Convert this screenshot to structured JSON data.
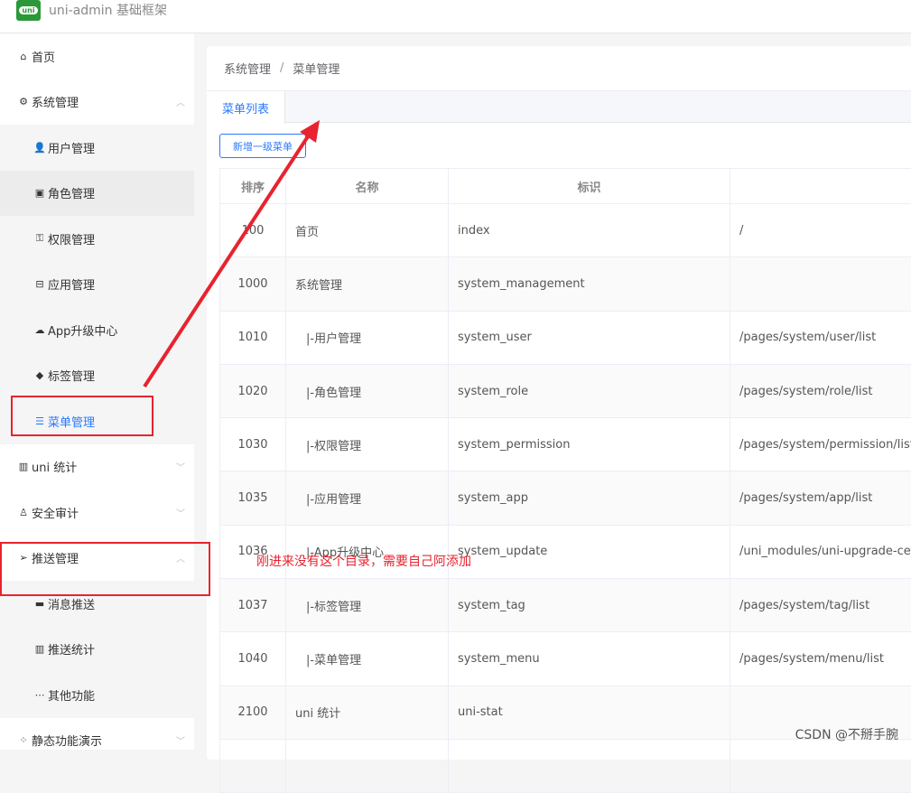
{
  "header": {
    "logo_text": "uni",
    "title": "uni-admin 基础框架"
  },
  "sidebar": {
    "items": [
      {
        "label": "首页",
        "icon": "home-icon",
        "level": 0
      },
      {
        "label": "系统管理",
        "icon": "gear-icon",
        "level": 0,
        "chev": "up"
      },
      {
        "label": "用户管理",
        "icon": "user-icon",
        "level": 1
      },
      {
        "label": "角色管理",
        "icon": "role-icon",
        "level": 1
      },
      {
        "label": "权限管理",
        "icon": "permission-icon",
        "level": 1
      },
      {
        "label": "应用管理",
        "icon": "app-icon",
        "level": 1
      },
      {
        "label": "App升级中心",
        "icon": "cloud-upload-icon",
        "level": 1
      },
      {
        "label": "标签管理",
        "icon": "tag-icon",
        "level": 1
      },
      {
        "label": "菜单管理",
        "icon": "list-icon",
        "level": 1,
        "active": true
      },
      {
        "label": "uni 统计",
        "icon": "chart-icon",
        "level": 0,
        "chev": "down"
      },
      {
        "label": "安全审计",
        "icon": "audit-icon",
        "level": 0,
        "chev": "down"
      },
      {
        "label": "推送管理",
        "icon": "send-icon",
        "level": 0,
        "chev": "up"
      },
      {
        "label": "消息推送",
        "icon": "message-icon",
        "level": 1
      },
      {
        "label": "推送统计",
        "icon": "chart-icon",
        "level": 1
      },
      {
        "label": "其他功能",
        "icon": "more-icon",
        "level": 1
      },
      {
        "label": "静态功能演示",
        "icon": "grid-icon",
        "level": 0,
        "chev": "down"
      }
    ]
  },
  "breadcrumb": {
    "parent": "系统管理",
    "sep": "/",
    "current": "菜单管理"
  },
  "tabs": {
    "active": "菜单列表"
  },
  "toolbar": {
    "add_label": "新增一级菜单"
  },
  "table": {
    "headers": [
      "排序",
      "名称",
      "标识",
      ""
    ],
    "rows": [
      [
        "100",
        "首页",
        "index",
        "/"
      ],
      [
        "1000",
        "系统管理",
        "system_management",
        ""
      ],
      [
        "1010",
        "|-用户管理",
        "system_user",
        "/pages/system/user/list"
      ],
      [
        "1020",
        "|-角色管理",
        "system_role",
        "/pages/system/role/list"
      ],
      [
        "1030",
        "|-权限管理",
        "system_permission",
        "/pages/system/permission/list"
      ],
      [
        "1035",
        "|-应用管理",
        "system_app",
        "/pages/system/app/list"
      ],
      [
        "1036",
        "|-App升级中心",
        "system_update",
        "/uni_modules/uni-upgrade-center"
      ],
      [
        "1037",
        "|-标签管理",
        "system_tag",
        "/pages/system/tag/list"
      ],
      [
        "1040",
        "|-菜单管理",
        "system_menu",
        "/pages/system/menu/list"
      ],
      [
        "2100",
        "uni 统计",
        "uni-stat",
        ""
      ],
      [
        "",
        "",
        "",
        ""
      ]
    ]
  },
  "annotation": {
    "note": "刚进来没有这个目录，需要自己阿添加",
    "color": "#e8232f"
  },
  "watermark": "CSDN @不掰手腕"
}
